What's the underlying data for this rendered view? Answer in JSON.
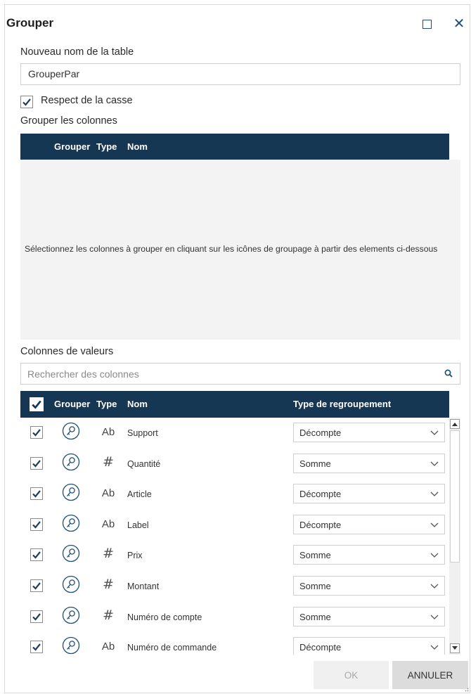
{
  "dialog": {
    "title": "Grouper",
    "new_table_label": "Nouveau nom de la table",
    "new_table_value": "GrouperPar",
    "case_checkbox_label": "Respect de la casse",
    "case_checked": true
  },
  "group_columns": {
    "label": "Grouper les colonnes",
    "headers": {
      "group": "Grouper",
      "type": "Type",
      "name": "Nom"
    },
    "empty_message": "Sélectionnez les colonnes à grouper en cliquant sur les icônes de groupage à partir des elements ci-dessous"
  },
  "value_columns": {
    "label": "Colonnes de valeurs",
    "search_placeholder": "Rechercher des colonnes",
    "headers": {
      "group": "Grouper",
      "type": "Type",
      "name": "Nom",
      "aggregation": "Type de regroupement"
    },
    "rows": [
      {
        "checked": true,
        "type": "Ab",
        "type_icon": "text-type",
        "name": "Support",
        "aggregation": "Décompte"
      },
      {
        "checked": true,
        "type": "#",
        "type_icon": "number-type",
        "name": "Quantité",
        "aggregation": "Somme"
      },
      {
        "checked": true,
        "type": "Ab",
        "type_icon": "text-type",
        "name": "Article",
        "aggregation": "Décompte"
      },
      {
        "checked": true,
        "type": "Ab",
        "type_icon": "text-type",
        "name": "Label",
        "aggregation": "Décompte"
      },
      {
        "checked": true,
        "type": "#",
        "type_icon": "number-type",
        "name": "Prix",
        "aggregation": "Somme"
      },
      {
        "checked": true,
        "type": "#",
        "type_icon": "number-type",
        "name": "Montant",
        "aggregation": "Somme"
      },
      {
        "checked": true,
        "type": "#",
        "type_icon": "number-type",
        "name": "Numéro de compte",
        "aggregation": "Somme"
      },
      {
        "checked": true,
        "type": "Ab",
        "type_icon": "text-type",
        "name": "Numéro de commande",
        "aggregation": "Décompte"
      }
    ]
  },
  "buttons": {
    "ok": "OK",
    "cancel": "ANNULER"
  },
  "colors": {
    "header_bg": "#163754",
    "accent": "#1d4f7a",
    "check": "#1e3f5c"
  }
}
